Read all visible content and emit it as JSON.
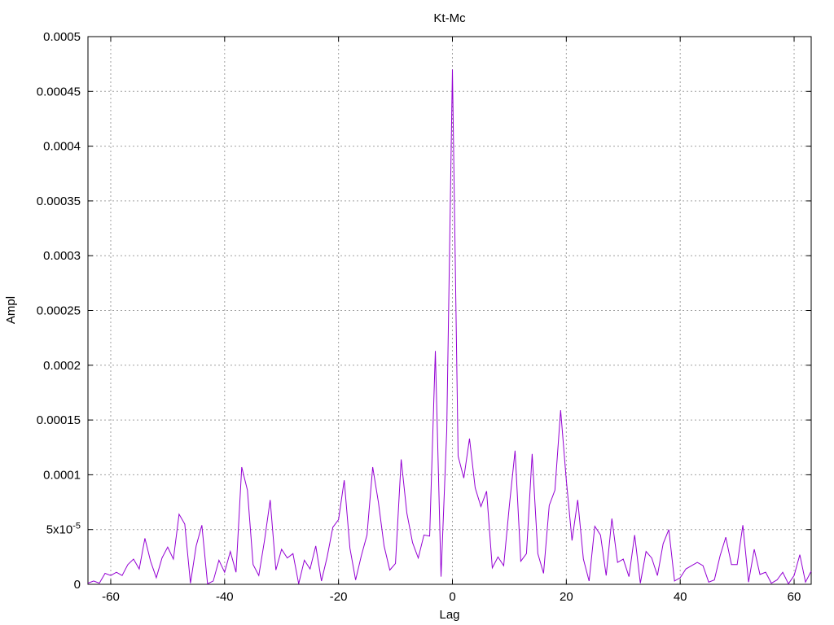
{
  "chart_data": {
    "type": "line",
    "title": "Kt-Mc",
    "xlabel": "Lag",
    "ylabel": "Ampl",
    "xlim": [
      -64,
      63
    ],
    "ylim": [
      0,
      0.0005
    ],
    "grid": true,
    "x_ticks": [
      {
        "value": -60,
        "label": "-60"
      },
      {
        "value": -40,
        "label": "-40"
      },
      {
        "value": -20,
        "label": "-20"
      },
      {
        "value": 0,
        "label": "0"
      },
      {
        "value": 20,
        "label": "20"
      },
      {
        "value": 40,
        "label": "40"
      },
      {
        "value": 60,
        "label": "60"
      }
    ],
    "y_ticks": [
      {
        "value": 0,
        "label": "0"
      },
      {
        "value": 5e-05,
        "label": "5x10",
        "exp": "-5"
      },
      {
        "value": 0.0001,
        "label": "0.0001"
      },
      {
        "value": 0.00015,
        "label": "0.00015"
      },
      {
        "value": 0.0002,
        "label": "0.0002"
      },
      {
        "value": 0.00025,
        "label": "0.00025"
      },
      {
        "value": 0.0003,
        "label": "0.0003"
      },
      {
        "value": 0.00035,
        "label": "0.00035"
      },
      {
        "value": 0.0004,
        "label": "0.0004"
      },
      {
        "value": 0.00045,
        "label": "0.00045"
      },
      {
        "value": 0.0005,
        "label": "0.0005"
      }
    ],
    "colors": {
      "series": "#9400d3",
      "grid": "#a0a0a0",
      "axis": "#000000"
    },
    "series": [
      {
        "x": [
          -64,
          -63,
          -62,
          -61,
          -60,
          -59,
          -58,
          -57,
          -56,
          -55,
          -54,
          -53,
          -52,
          -51,
          -50,
          -49,
          -48,
          -47,
          -46,
          -45,
          -44,
          -43,
          -42,
          -41,
          -40,
          -39,
          -38,
          -37,
          -36,
          -35,
          -34,
          -33,
          -32,
          -31,
          -30,
          -29,
          -28,
          -27,
          -26,
          -25,
          -24,
          -23,
          -22,
          -21,
          -20,
          -19,
          -18,
          -17,
          -16,
          -15,
          -14,
          -13,
          -12,
          -11,
          -10,
          -9,
          -8,
          -7,
          -6,
          -5,
          -4,
          -3,
          -2,
          -1,
          0,
          1,
          2,
          3,
          4,
          5,
          6,
          7,
          8,
          9,
          10,
          11,
          12,
          13,
          14,
          15,
          16,
          17,
          18,
          19,
          20,
          21,
          22,
          23,
          24,
          25,
          26,
          27,
          28,
          29,
          30,
          31,
          32,
          33,
          34,
          35,
          36,
          37,
          38,
          39,
          40,
          41,
          42,
          43,
          44,
          45,
          46,
          47,
          48,
          49,
          50,
          51,
          52,
          53,
          54,
          55,
          56,
          57,
          58,
          59,
          60,
          61,
          62,
          63
        ],
        "y": [
          1e-06,
          3e-06,
          1e-06,
          1e-05,
          8e-06,
          1.1e-05,
          8e-06,
          1.8e-05,
          2.3e-05,
          1.4e-05,
          4.2e-05,
          2.1e-05,
          6e-06,
          2.4e-05,
          3.4e-05,
          2.3e-05,
          6.4e-05,
          5.5e-05,
          1e-06,
          3.5e-05,
          5.4e-05,
          5e-07,
          3e-06,
          2.2e-05,
          1.1e-05,
          3e-05,
          1.1e-05,
          0.000107,
          8.6e-05,
          1.8e-05,
          8e-06,
          4e-05,
          7.7e-05,
          1.3e-05,
          3.2e-05,
          2.4e-05,
          2.8e-05,
          5e-07,
          2.2e-05,
          1.4e-05,
          3.5e-05,
          3e-06,
          2.5e-05,
          5.2e-05,
          5.9e-05,
          9.5e-05,
          3.3e-05,
          4e-06,
          2.6e-05,
          4.5e-05,
          0.000107,
          7.5e-05,
          3.5e-05,
          1.3e-05,
          1.9e-05,
          0.000114,
          6.5e-05,
          3.8e-05,
          2.4e-05,
          4.5e-05,
          4.4e-05,
          0.000213,
          7e-06,
          0.00014,
          0.00047,
          0.000117,
          9.7e-05,
          0.000133,
          8.8e-05,
          7.1e-05,
          8.5e-05,
          1.5e-05,
          2.5e-05,
          1.7e-05,
          7.2e-05,
          0.000122,
          2.1e-05,
          2.8e-05,
          0.000119,
          2.8e-05,
          1e-05,
          7.2e-05,
          8.6e-05,
          0.000159,
          9.5e-05,
          4e-05,
          7.7e-05,
          2.3e-05,
          3e-06,
          5.3e-05,
          4.5e-05,
          8e-06,
          6e-05,
          2e-05,
          2.3e-05,
          7e-06,
          4.5e-05,
          1e-06,
          3e-05,
          2.4e-05,
          8e-06,
          3.7e-05,
          5e-05,
          3e-06,
          6e-06,
          1.4e-05,
          1.7e-05,
          2e-05,
          1.7e-05,
          2e-06,
          4e-06,
          2.6e-05,
          4.3e-05,
          1.8e-05,
          1.8e-05,
          5.4e-05,
          2e-06,
          3.2e-05,
          9e-06,
          1.1e-05,
          1e-06,
          4e-06,
          1.1e-05,
          5e-07,
          8e-06,
          2.7e-05,
          2e-06,
          1.2e-05
        ]
      }
    ]
  }
}
